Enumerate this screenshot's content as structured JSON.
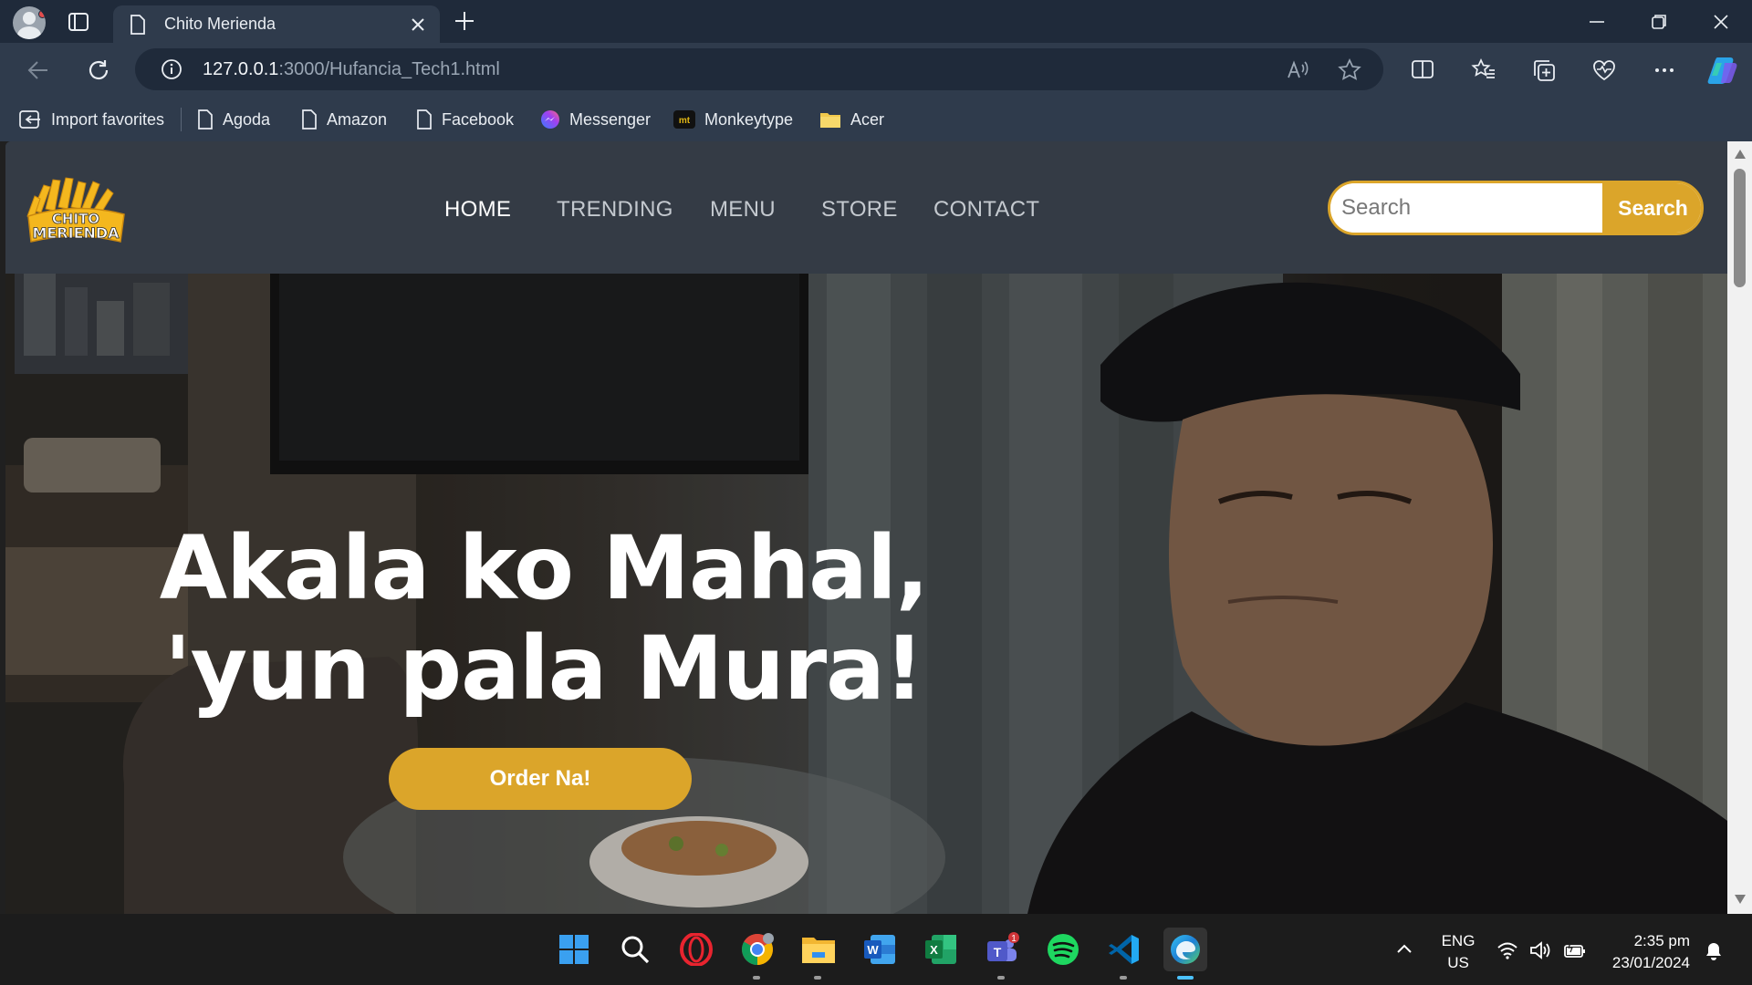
{
  "browser": {
    "tab_title": "Chito Merienda",
    "url_host": "127.0.0.1",
    "url_rest": ":3000/Hufancia_Tech1.html",
    "bookmarks": [
      {
        "label": "Import favorites",
        "icon": "import-icon"
      },
      {
        "label": "Agoda",
        "icon": "page-icon"
      },
      {
        "label": "Amazon",
        "icon": "page-icon"
      },
      {
        "label": "Facebook",
        "icon": "page-icon"
      },
      {
        "label": "Messenger",
        "icon": "messenger-icon"
      },
      {
        "label": "Monkeytype",
        "icon": "monkeytype-icon"
      },
      {
        "label": "Acer",
        "icon": "folder-icon"
      }
    ]
  },
  "site": {
    "logo_text_top": "CHITO",
    "logo_text_bottom": "MERIENDA",
    "nav": [
      {
        "label": "HOME",
        "active": true
      },
      {
        "label": "TRENDING",
        "active": false
      },
      {
        "label": "MENU",
        "active": false
      },
      {
        "label": "STORE",
        "active": false
      },
      {
        "label": "CONTACT",
        "active": false
      }
    ],
    "search_placeholder": "Search",
    "search_button": "Search",
    "headline_line1": "Akala ko Mahal,",
    "headline_line2": "'yun pala Mura!",
    "order_button": "Order Na!",
    "accent_color": "#dba52a"
  },
  "taskbar": {
    "apps": [
      "windows-start",
      "search",
      "opera",
      "chrome",
      "file-explorer",
      "word",
      "excel",
      "teams",
      "spotify",
      "vscode",
      "edge"
    ],
    "teams_badge": "1",
    "language_line1": "ENG",
    "language_line2": "US",
    "time": "2:35 pm",
    "date": "23/01/2024"
  }
}
